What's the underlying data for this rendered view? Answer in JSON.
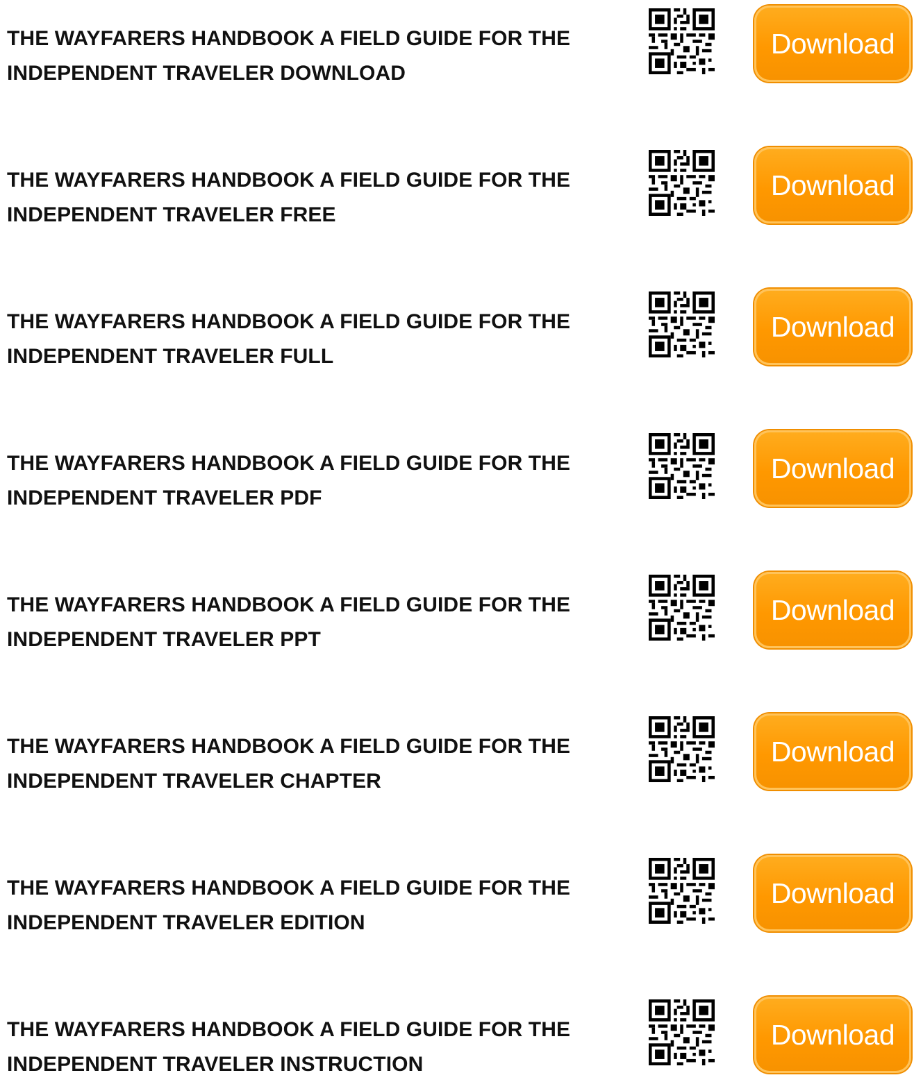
{
  "colors": {
    "button_bg": "#ff9800",
    "button_text": "#ffffff",
    "title_text": "#111111"
  },
  "icons": {
    "qr": "qr-code-icon"
  },
  "items": [
    {
      "title_line1": "THE WAYFARERS HANDBOOK A FIELD GUIDE FOR THE",
      "title_line2": "INDEPENDENT TRAVELER DOWNLOAD",
      "button_label": "Download"
    },
    {
      "title_line1": "THE WAYFARERS HANDBOOK A FIELD GUIDE FOR THE",
      "title_line2": "INDEPENDENT TRAVELER FREE",
      "button_label": "Download"
    },
    {
      "title_line1": "THE WAYFARERS HANDBOOK A FIELD GUIDE FOR THE",
      "title_line2": "INDEPENDENT TRAVELER FULL",
      "button_label": "Download"
    },
    {
      "title_line1": "THE WAYFARERS HANDBOOK A FIELD GUIDE FOR THE",
      "title_line2": "INDEPENDENT TRAVELER PDF",
      "button_label": "Download"
    },
    {
      "title_line1": "THE WAYFARERS HANDBOOK A FIELD GUIDE FOR THE",
      "title_line2": "INDEPENDENT TRAVELER PPT",
      "button_label": "Download"
    },
    {
      "title_line1": "THE WAYFARERS HANDBOOK A FIELD GUIDE FOR THE",
      "title_line2": "INDEPENDENT TRAVELER CHAPTER",
      "button_label": "Download"
    },
    {
      "title_line1": "THE WAYFARERS HANDBOOK A FIELD GUIDE FOR THE",
      "title_line2": "INDEPENDENT TRAVELER EDITION",
      "button_label": "Download"
    },
    {
      "title_line1": "THE WAYFARERS HANDBOOK A FIELD GUIDE FOR THE",
      "title_line2": "INDEPENDENT TRAVELER INSTRUCTION",
      "button_label": "Download"
    }
  ]
}
